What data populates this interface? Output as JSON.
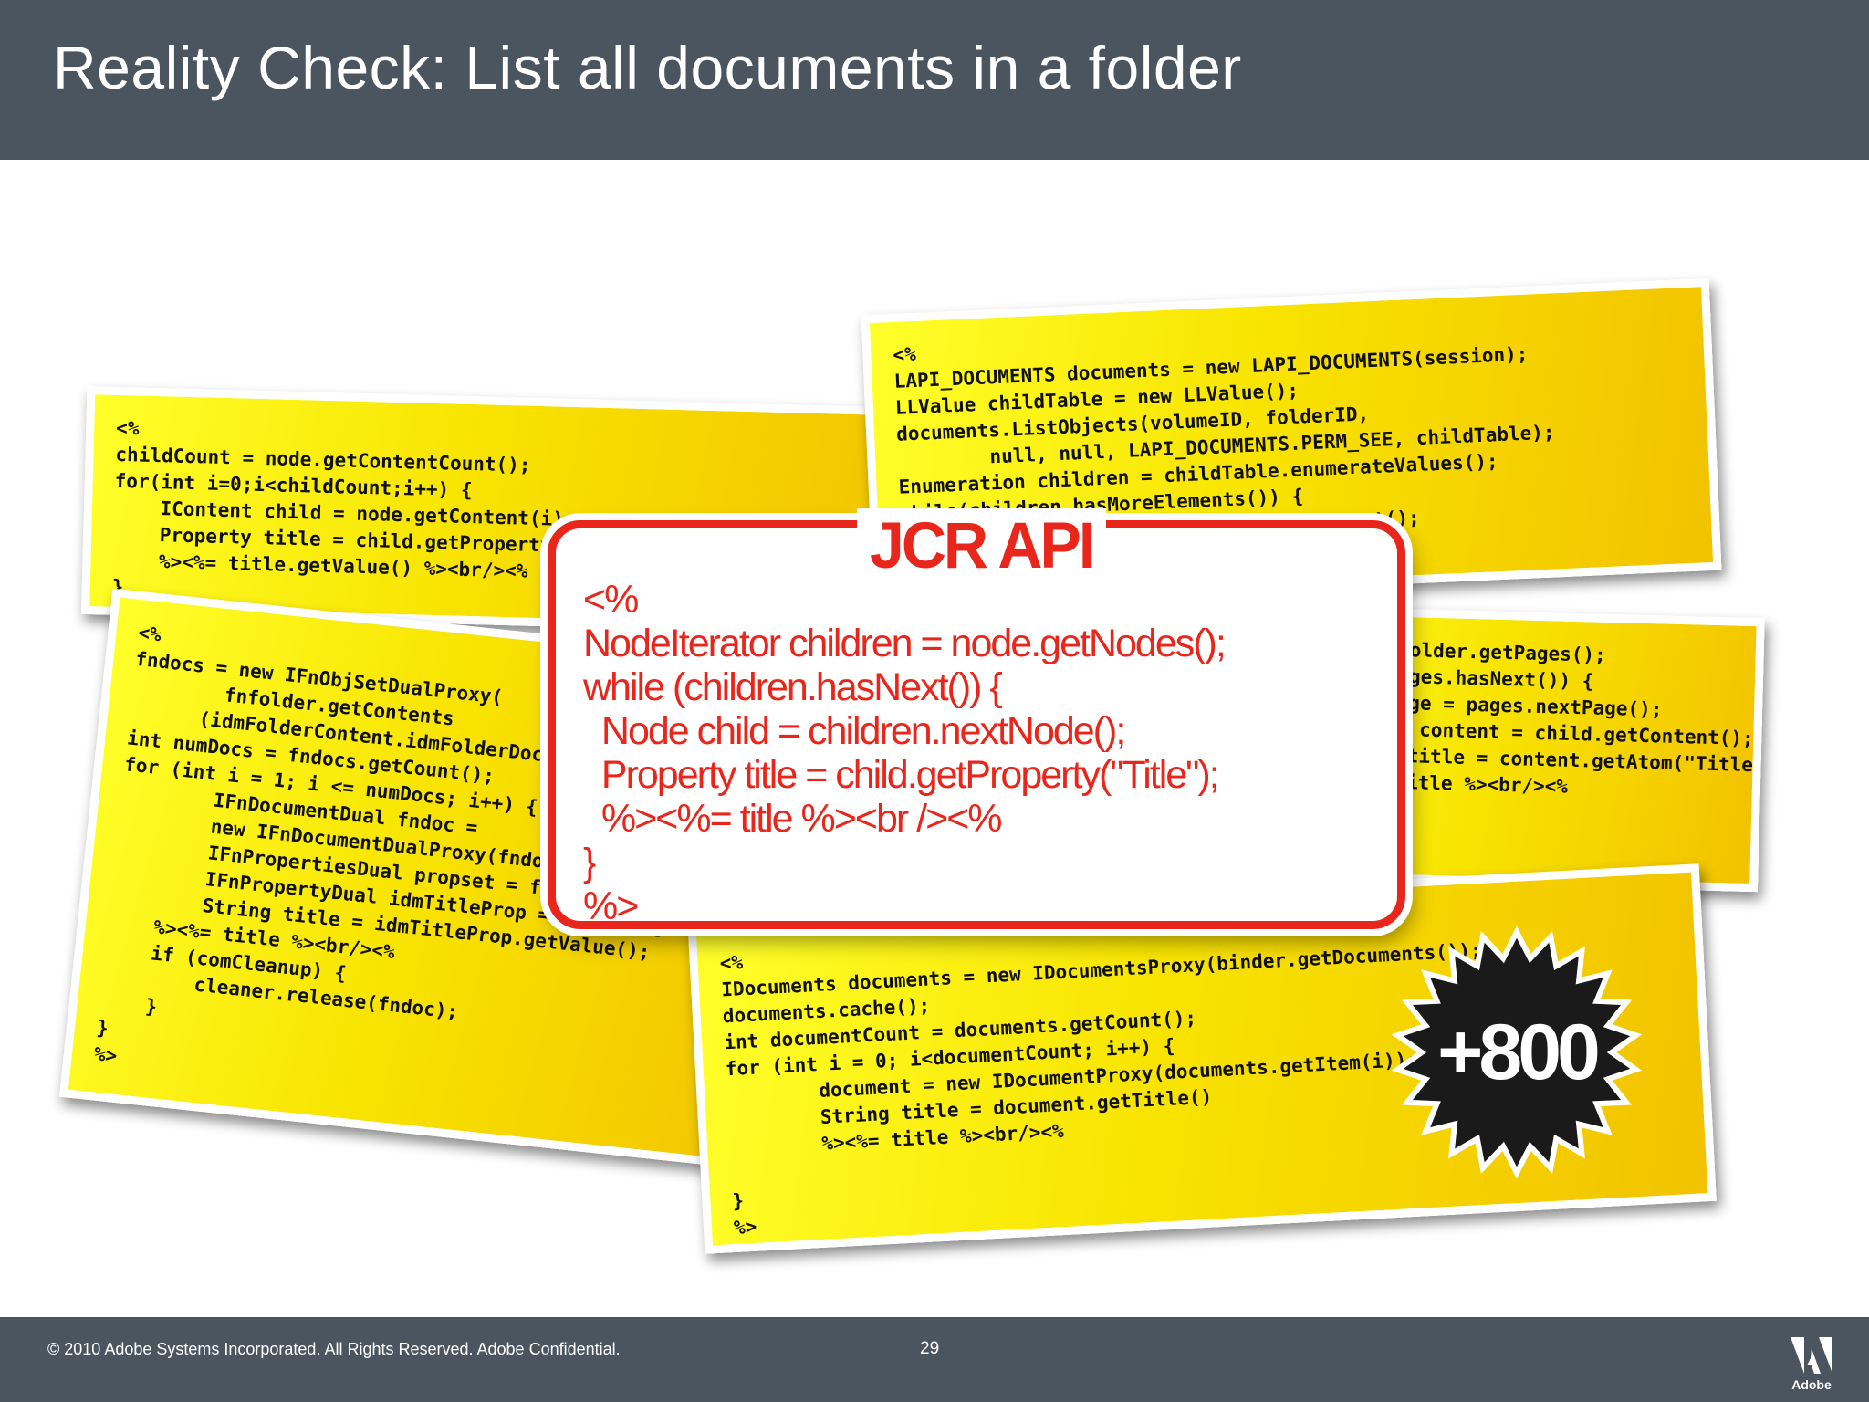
{
  "slide": {
    "title": "Reality Check: List all documents in a folder"
  },
  "cards": {
    "top_left": "<%\nchildCount = node.getContentCount();\nfor(int i=0;i<childCount;i++) {\n    IContent child = node.getContent(i);\n    Property title = child.getProperty(\"Title\");\n    %><%= title.getValue() %><br/><%\n}\n%>",
    "left_bottom": "<%\nfndocs = new IFnObjSetDualProxy(\n        fnfolder.getContents\n      (idmFolderContent.idmFolderDocuments));\nint numDocs = fndocs.getCount();\nfor (int i = 1; i <= numDocs; i++) {\n        IFnDocumentDual fndoc =\n        new IFnDocumentDualProxy(fndocs.getItem(i));\n        IFnPropertiesDual propset = fndoc.getProperties();\n        IFnPropertyDual idmTitleProp = propset.getItem(\"Title\");\n        String title = idmTitleProp.getValue();\n    %><%= title %><br/><%\n    if (comCleanup) {\n        cleaner.release(fndoc);\n    }\n}\n%>",
    "top_right": "<%\nLAPI_DOCUMENTS documents = new LAPI_DOCUMENTS(session);\nLLValue childTable = new LLValue();\ndocuments.ListObjects(volumeID, folderID,\n        null, null, LAPI_DOCUMENTS.PERM_SEE, childTable);\nEnumeration children = childTable.enumerateValues();\nwhile(children.hasMoreElements()) {\n    LLValue child = (LLValue)e.nextElement();\n    %><%= child.toString(\"Name\"); %><br/><%\n}\n%>",
    "mid_right": "  pages = folder.getPages();\n  while (pages.hasNext()) {\n    Page page = pages.nextPage();\n    Content content = child.getContent();\n    String title = content.getAtom(\"Title\");\n    %><%= title %><br/><%\n  }",
    "bottom_right": "<%\nIDocuments documents = new IDocumentsProxy(binder.getDocuments());\ndocuments.cache();\nint documentCount = documents.getCount();\nfor (int i = 0; i<documentCount; i++) {\n        document = new IDocumentProxy(documents.getItem(i));\n        String title = document.getTitle()\n        %><%= title %><br/><%\n\n}\n%>"
  },
  "jcr": {
    "label": "JCR API",
    "code": "<%\nNodeIterator children = node.getNodes();\nwhile (children.hasNext()) {\n  Node child = children.nextNode();\n  Property title = child.getProperty(\"Title\");\n  %><%= title %><br /><%\n}\n%>"
  },
  "badge": {
    "text": "+800",
    "color": "#1a1a1a"
  },
  "footer": {
    "copyright": "© 2010 Adobe Systems Incorporated.  All Rights Reserved.  Adobe Confidential.",
    "page_number": "29",
    "logo_word": "Adobe"
  },
  "colors": {
    "header_bg": "#4a5560",
    "card_yellow": "#f8e400",
    "jcr_red": "#e8261b"
  }
}
